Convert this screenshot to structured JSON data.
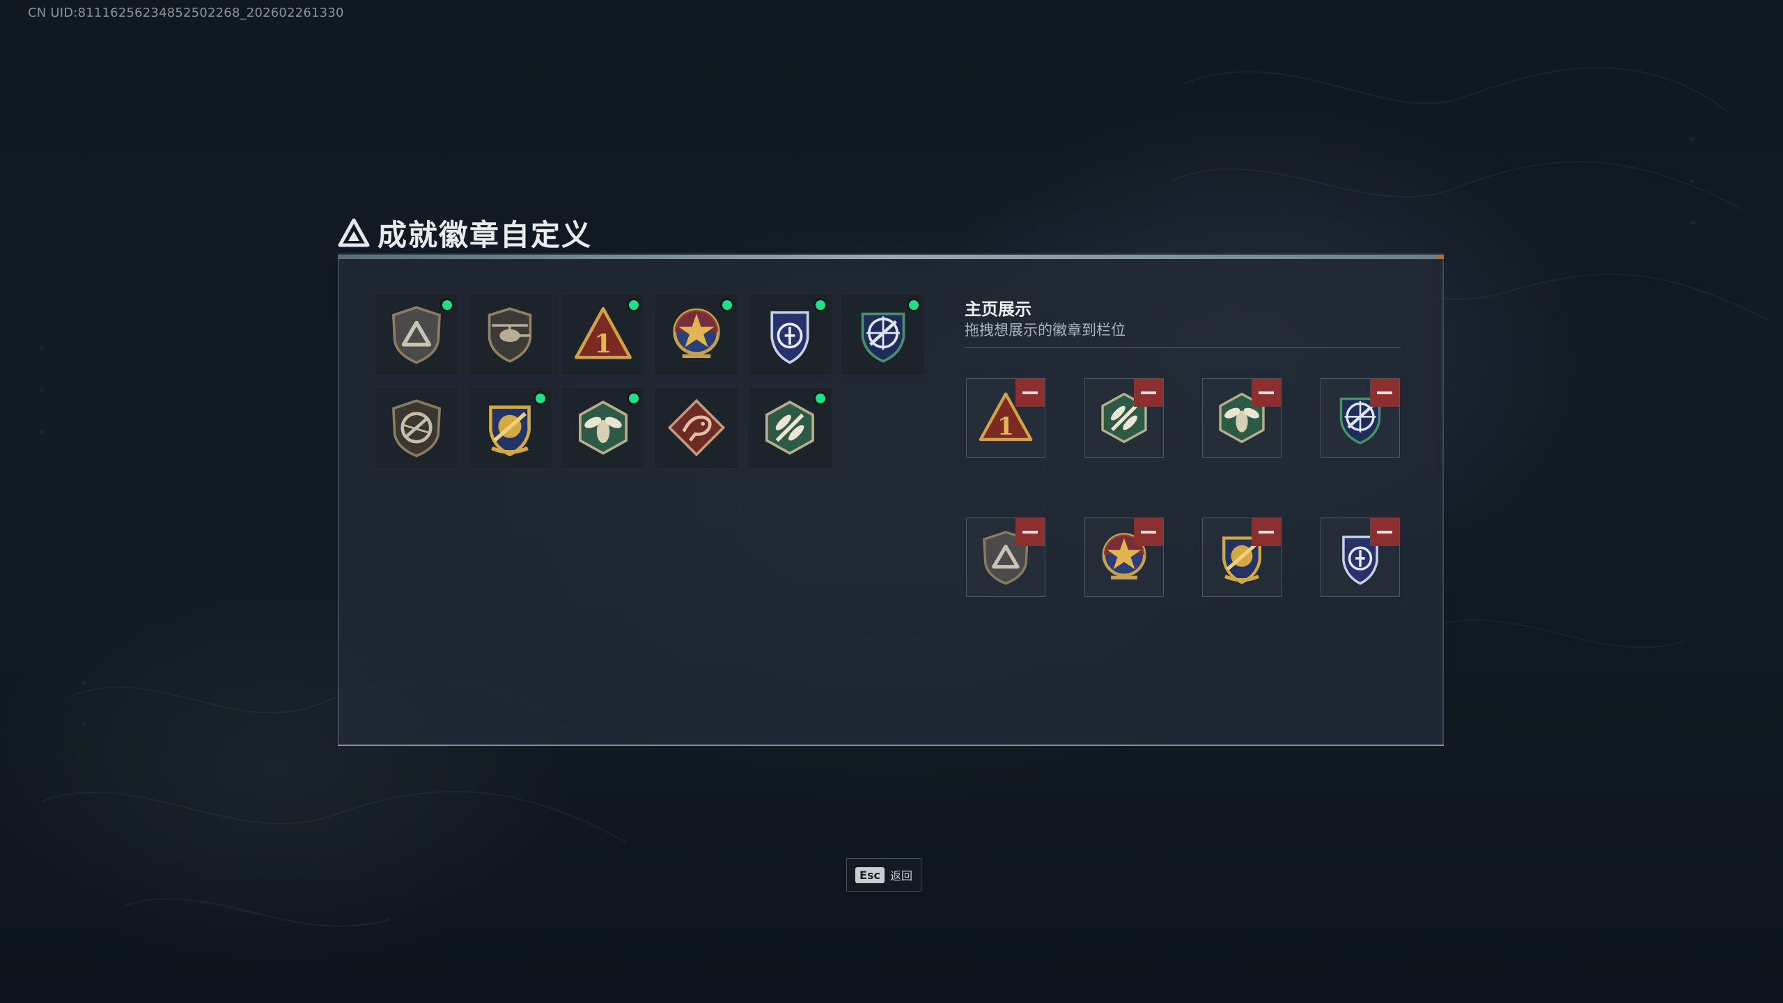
{
  "uid_text": "CN UID:81116256234852502268_202602261330",
  "page": {
    "title": "成就徽章自定义",
    "title_tag": ""
  },
  "owned_badges": [
    {
      "icon": "triangle-shield-badge-icon",
      "selected": true
    },
    {
      "icon": "helicopter-shield-badge-icon",
      "selected": false
    },
    {
      "icon": "number-one-triangle-badge-icon",
      "selected": true
    },
    {
      "icon": "gold-star-medal-badge-icon",
      "selected": true
    },
    {
      "icon": "blue-police-shield-badge-icon",
      "selected": true
    },
    {
      "icon": "crosshair-rifle-badge-icon",
      "selected": true
    },
    {
      "icon": "no-rifle-shield-badge-icon",
      "selected": false
    },
    {
      "icon": "gold-cannon-badge-icon",
      "selected": true
    },
    {
      "icon": "green-hornet-badge-icon",
      "selected": true
    },
    {
      "icon": "red-dragon-badge-icon",
      "selected": false
    },
    {
      "icon": "green-dragonfly-badge-icon",
      "selected": true
    }
  ],
  "showcase": {
    "title": "主页展示",
    "subtitle": "拖拽想展示的徽章到栏位",
    "slots": [
      {
        "icon": "number-one-triangle-badge-icon"
      },
      {
        "icon": "green-dragonfly-badge-icon"
      },
      {
        "icon": "green-hornet-badge-icon"
      },
      {
        "icon": "crosshair-rifle-badge-icon"
      },
      {
        "icon": "triangle-shield-badge-icon"
      },
      {
        "icon": "gold-star-medal-badge-icon"
      },
      {
        "icon": "gold-cannon-badge-icon"
      },
      {
        "icon": "blue-police-shield-badge-icon"
      }
    ]
  },
  "footer": {
    "key": "Esc",
    "label": "返回"
  },
  "colors": {
    "selected_dot": "#1fe08a",
    "remove_button": "#8d2f2f",
    "panel_bg": "#212a34"
  }
}
